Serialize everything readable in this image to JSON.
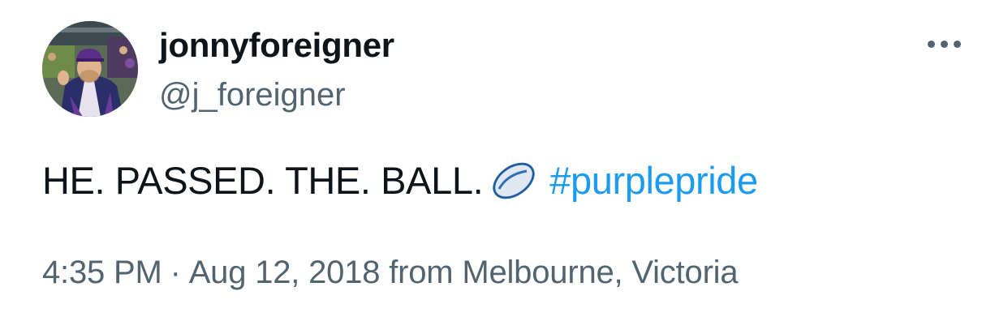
{
  "tweet": {
    "author": {
      "display_name": "jonnyforeigner",
      "handle": "@j_foreigner",
      "avatar_icon": "profile-photo"
    },
    "more_icon": "more-dots-icon",
    "text": "HE. PASSED. THE. BALL.",
    "emoji": "rugby-ball-emoji",
    "hashtag": "#purplepride",
    "timestamp": "4:35 PM",
    "separator": "·",
    "date": "Aug 12, 2018",
    "location_text": "from Melbourne, Victoria"
  },
  "colors": {
    "text_primary": "#0f1419",
    "text_secondary": "#536471",
    "link": "#1d9bf0",
    "background": "#ffffff"
  }
}
